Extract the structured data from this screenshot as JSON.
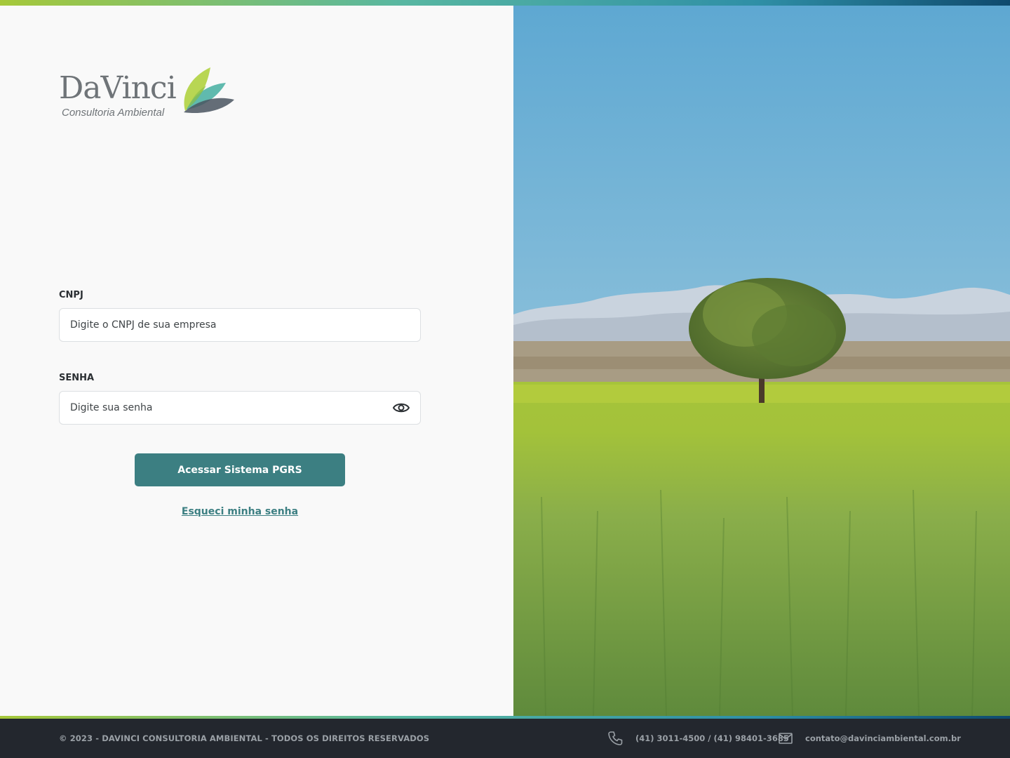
{
  "brand": {
    "name": "DaVinci",
    "tagline": "Consultoria Ambiental",
    "colors": {
      "primary": "#3c7f82",
      "leaf_green": "#b4d44a",
      "leaf_teal": "#4fb3a5",
      "leaf_dark": "#4a5560"
    }
  },
  "form": {
    "cnpj_label": "CNPJ",
    "cnpj_placeholder": "Digite o CNPJ de sua empresa",
    "password_label": "SENHA",
    "password_placeholder": "Digite sua senha",
    "password_toggle_icon": "eye-icon",
    "submit_label": "Acessar Sistema PGRS",
    "forgot_label": "Esqueci minha senha"
  },
  "hero": {
    "icon": "landscape-photo"
  },
  "footer": {
    "copyright": "© 2023 - DAVINCI CONSULTORIA AMBIENTAL - TODOS OS DIREITOS RESERVADOS",
    "phone_icon": "phone-icon",
    "phone": "(41) 3011-4500 / (41) 98401-3685",
    "email_icon": "mail-icon",
    "email": "contato@davinciambiental.com.br"
  }
}
